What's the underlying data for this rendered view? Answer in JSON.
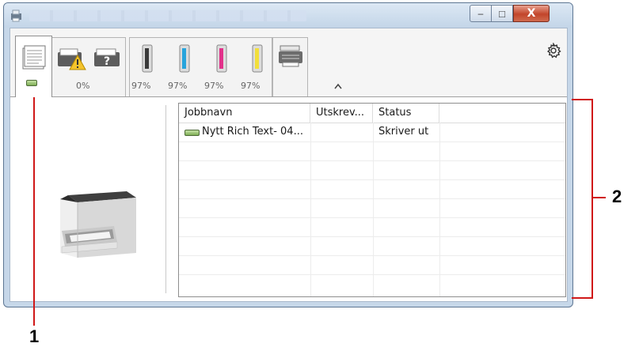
{
  "window": {
    "minimize_glyph": "–",
    "maximize_glyph": "□",
    "close_glyph": "X"
  },
  "toolbar": {
    "paper_tray_percent": "0%",
    "toner_levels": [
      "97%",
      "97%",
      "97%",
      "97%"
    ],
    "toner_colors": [
      "#3a3a3a",
      "#27a4dc",
      "#e2318a",
      "#f2df3a"
    ]
  },
  "job_table": {
    "columns": [
      "Jobbnavn",
      "Utskrev...",
      "Status"
    ],
    "rows": [
      {
        "name": "Nytt Rich Text- 04...",
        "printed": "",
        "status": "Skriver ut"
      }
    ]
  },
  "callouts": {
    "one": "1",
    "two": "2"
  },
  "colors": {
    "callout_line": "#d01818",
    "job_icon": "#7eae55"
  }
}
